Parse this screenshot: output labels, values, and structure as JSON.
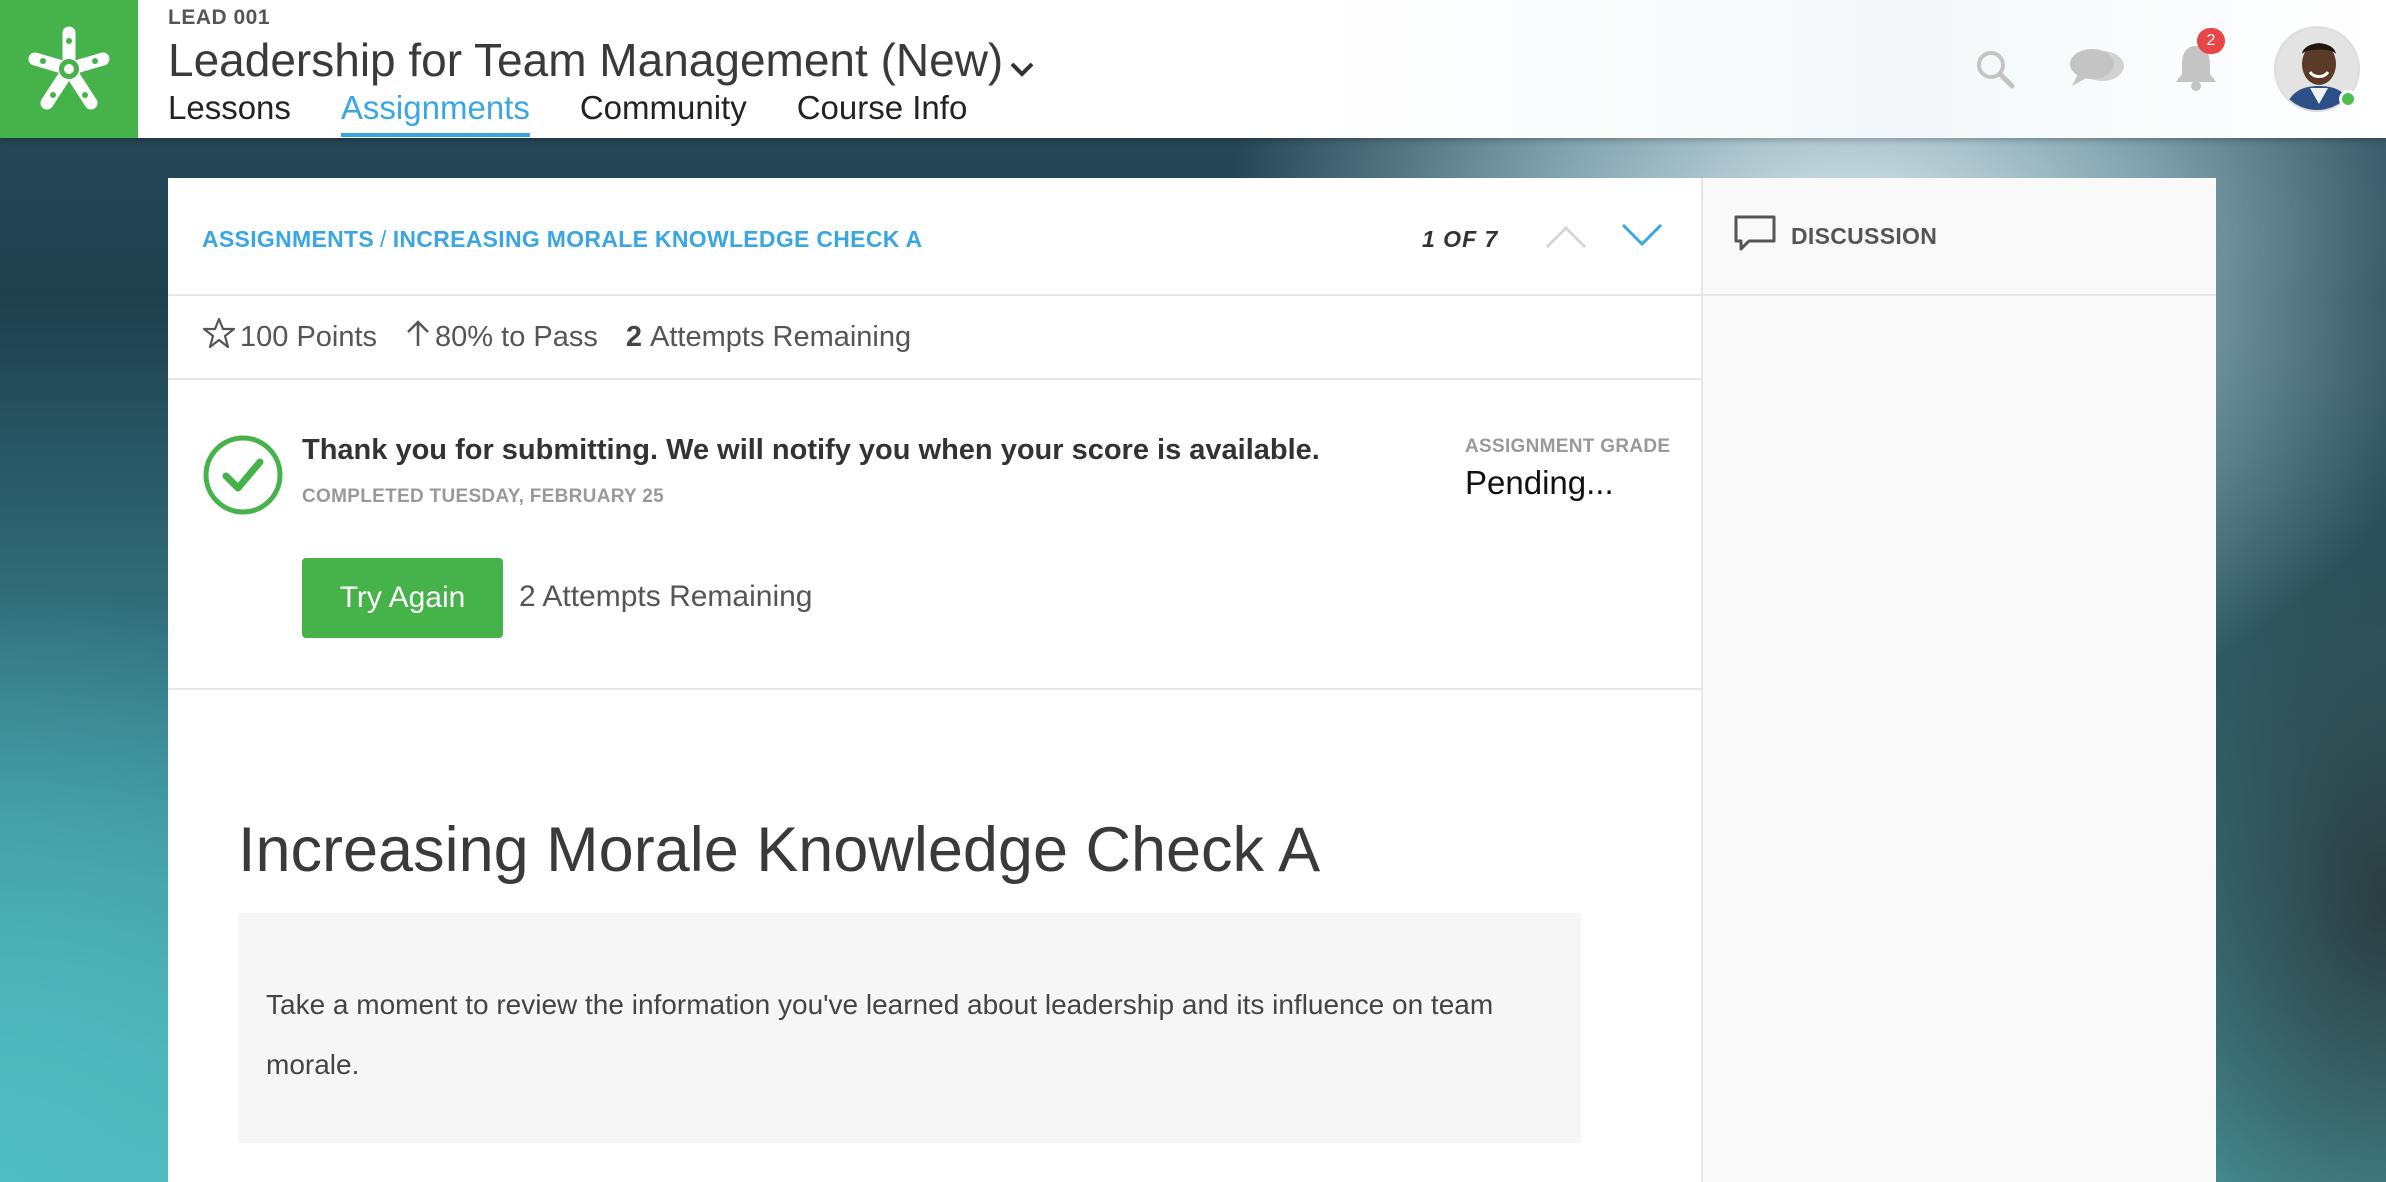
{
  "header": {
    "course_code": "LEAD 001",
    "course_title": "Leadership for Team Management (New)",
    "nav": [
      {
        "label": "Lessons"
      },
      {
        "label": "Assignments"
      },
      {
        "label": "Community"
      },
      {
        "label": "Course Info"
      }
    ],
    "active_nav": "Assignments",
    "notification_count": "2",
    "icons": [
      "logo-icon",
      "search-icon",
      "chat-icon",
      "bell-icon",
      "avatar"
    ],
    "colors": {
      "brand": "#45b349",
      "accent": "#3aa6e2",
      "badge": "#e84545"
    }
  },
  "assignment": {
    "breadcrumb_root": "ASSIGNMENTS",
    "breadcrumb_sep": "/",
    "breadcrumb_current": "INCREASING MORALE KNOWLEDGE CHECK A",
    "pager": "1 OF 7",
    "stats": {
      "points": "100 Points",
      "pass": "80% to Pass",
      "attempts_count": "2",
      "attempts_label": "Attempts Remaining"
    },
    "result": {
      "message": "Thank you for submitting. We will notify you when your score is available.",
      "completed": "COMPLETED TUESDAY, FEBRUARY 25",
      "grade_label": "ASSIGNMENT GRADE",
      "grade_value": "Pending...",
      "try_again": "Try Again",
      "attempts_note": "2 Attempts Remaining"
    },
    "title": "Increasing Morale Knowledge Check A",
    "instructions": "Take a moment to review the information you've learned about leadership and its influence on team morale."
  },
  "discussion": {
    "label": "DISCUSSION"
  }
}
